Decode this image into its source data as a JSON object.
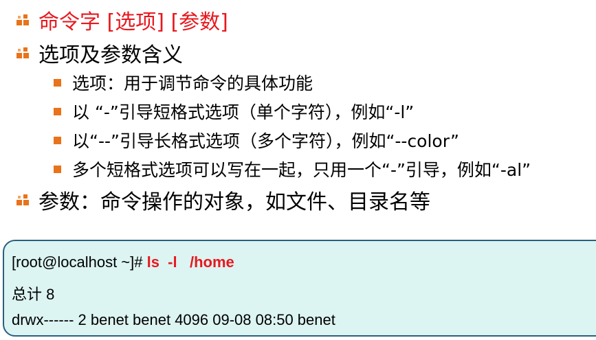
{
  "bullets": {
    "level1_1": "命令字  [选项]  [参数]",
    "level1_2": "选项及参数含义",
    "sub1": "选项：用于调节命令的具体功能",
    "sub2": "以 “-”引导短格式选项（单个字符），例如“-l”",
    "sub3": "以“--”引导长格式选项（多个字符），例如“--color”",
    "sub4": "多个短格式选项可以写在一起，只用一个“-”引导，例如“-al”",
    "level1_3": "参数：命令操作的对象，如文件、目录名等"
  },
  "terminal": {
    "prompt": "[root@localhost ~]# ",
    "command": "ls  -l   /home",
    "line2": "总计 8",
    "line3": "drwx------ 2 benet benet 4096 09-08 08:50 benet"
  },
  "colors": {
    "accent_red": "#E8181E",
    "bullet_orange": "#E8731A",
    "terminal_bg": "#dcf4f2",
    "terminal_border": "#2a5f7e"
  }
}
